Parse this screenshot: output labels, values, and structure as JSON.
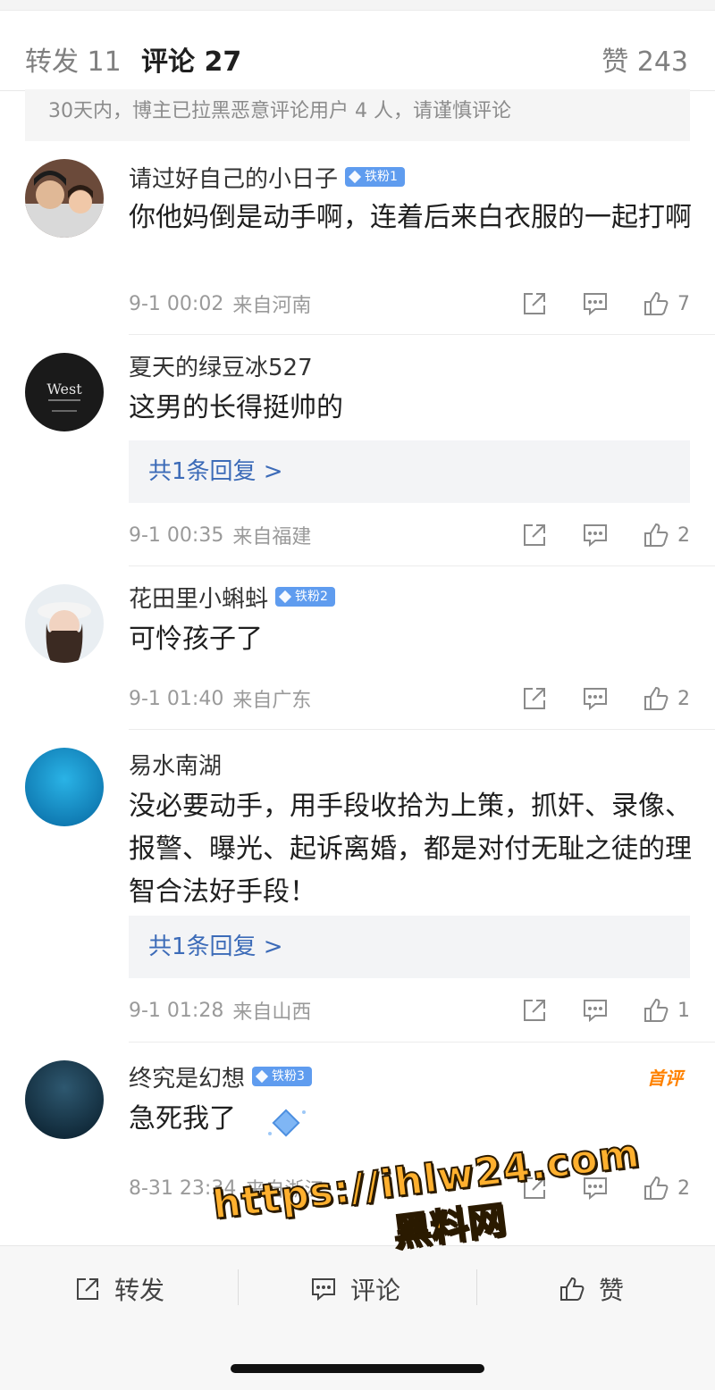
{
  "tabs": {
    "forward": "转发 11",
    "comment": "评论 27",
    "like": "赞 243"
  },
  "notice": "30天内，博主已拉黑恶意评论用户 4 人，请谨慎评论",
  "comments": [
    {
      "name": "请过好自己的小日子",
      "badge": "铁粉1",
      "text": "你他妈倒是动手啊，连着后来白衣服的一起打啊",
      "reply": "",
      "time": "9-1 00:02",
      "location": "来自河南",
      "likes": "7"
    },
    {
      "name": "夏天的绿豆冰527",
      "badge": "",
      "text": "这男的长得挺帅的",
      "reply": "共1条回复 >",
      "time": "9-1 00:35",
      "location": "来自福建",
      "likes": "2"
    },
    {
      "name": "花田里小蝌蚪",
      "badge": "铁粉2",
      "text": "可怜孩子了",
      "reply": "",
      "time": "9-1 01:40",
      "location": "来自广东",
      "likes": "2"
    },
    {
      "name": "易水南湖",
      "badge": "",
      "text": "没必要动手，用手段收拾为上策，抓奸、录像、报警、曝光、起诉离婚，都是对付无耻之徒的理智合法好手段！",
      "reply": "共1条回复 >",
      "time": "9-1 01:28",
      "location": "来自山西",
      "likes": "1"
    },
    {
      "name": "终究是幻想",
      "badge": "铁粉3",
      "first_tag": "首评",
      "text": "急死我了",
      "reply": "",
      "time": "8-31 23:34",
      "location": "来自浙江",
      "likes": "2"
    }
  ],
  "avatar_text": {
    "line1": "West"
  },
  "bottom_bar": {
    "forward": "转发",
    "comment": "评论",
    "like": "赞"
  },
  "watermark": {
    "url": "https://ihlw24.com",
    "name": "黑料网"
  },
  "colors": {
    "accent": "#ff8200",
    "badge": "#5f9cef",
    "link": "#3c6bb8"
  }
}
